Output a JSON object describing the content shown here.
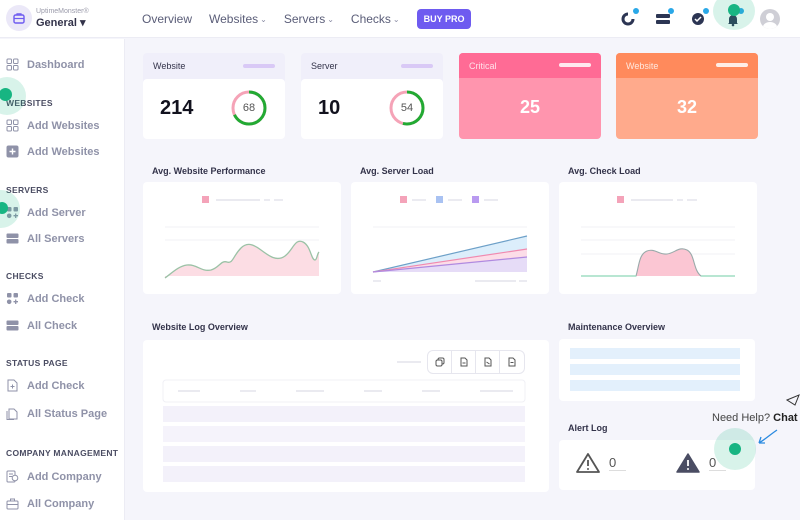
{
  "brand": {
    "sub": "UptimeMonster®",
    "workspace": "General ▾"
  },
  "nav": {
    "items": [
      {
        "label": "Overview",
        "dropdown": false
      },
      {
        "label": "Websites",
        "dropdown": true
      },
      {
        "label": "Servers",
        "dropdown": true
      },
      {
        "label": "Checks",
        "dropdown": true
      }
    ],
    "buy_pro": "BUY PRO",
    "chevron": "⌄"
  },
  "top_icons": [
    "uptime-icon",
    "server-icon",
    "check-icon",
    "bell-icon",
    "avatar"
  ],
  "sidebar": {
    "dashboard": "Dashboard",
    "sections": [
      {
        "heading": "WEBSITES",
        "items": [
          "Add Websites",
          "Add Websites"
        ]
      },
      {
        "heading": "SERVERS",
        "items": [
          "Add Server",
          "All Servers"
        ]
      },
      {
        "heading": "CHECKS",
        "items": [
          "Add Check",
          "All Check"
        ]
      },
      {
        "heading": "STATUS PAGE",
        "items": [
          "Add Check",
          "All Status Page"
        ]
      },
      {
        "heading": "COMPANY MANAGEMENT",
        "items": [
          "Add Company",
          "All Company"
        ]
      }
    ]
  },
  "stats": {
    "website": {
      "label": "Website",
      "value": "214",
      "ring": "68",
      "ring_percent": 68
    },
    "server": {
      "label": "Server",
      "value": "10",
      "ring": "54",
      "ring_percent": 54
    },
    "critical": {
      "label": "Critical",
      "value": "25",
      "color": "#ff6b95"
    },
    "website_alt": {
      "label": "Website",
      "value": "32",
      "color": "#ff8a5c"
    }
  },
  "panels": {
    "website_perf": "Avg. Website Performance",
    "server_load": "Avg. Server Load",
    "check_load": "Avg. Check Load",
    "log_overview": "Website Log Overview",
    "maintenance": "Maintenance Overview",
    "alert_log": "Alert Log"
  },
  "alerts": [
    {
      "icon": "warning-outline-icon",
      "count": "0"
    },
    {
      "icon": "warning-filled-icon",
      "count": "0"
    }
  ],
  "help": {
    "prefix": "Need Help? ",
    "link": "Chat w"
  },
  "colors": {
    "accent": "#6e5bf0",
    "pink": "#f7a6b8",
    "green": "#22aa33"
  }
}
